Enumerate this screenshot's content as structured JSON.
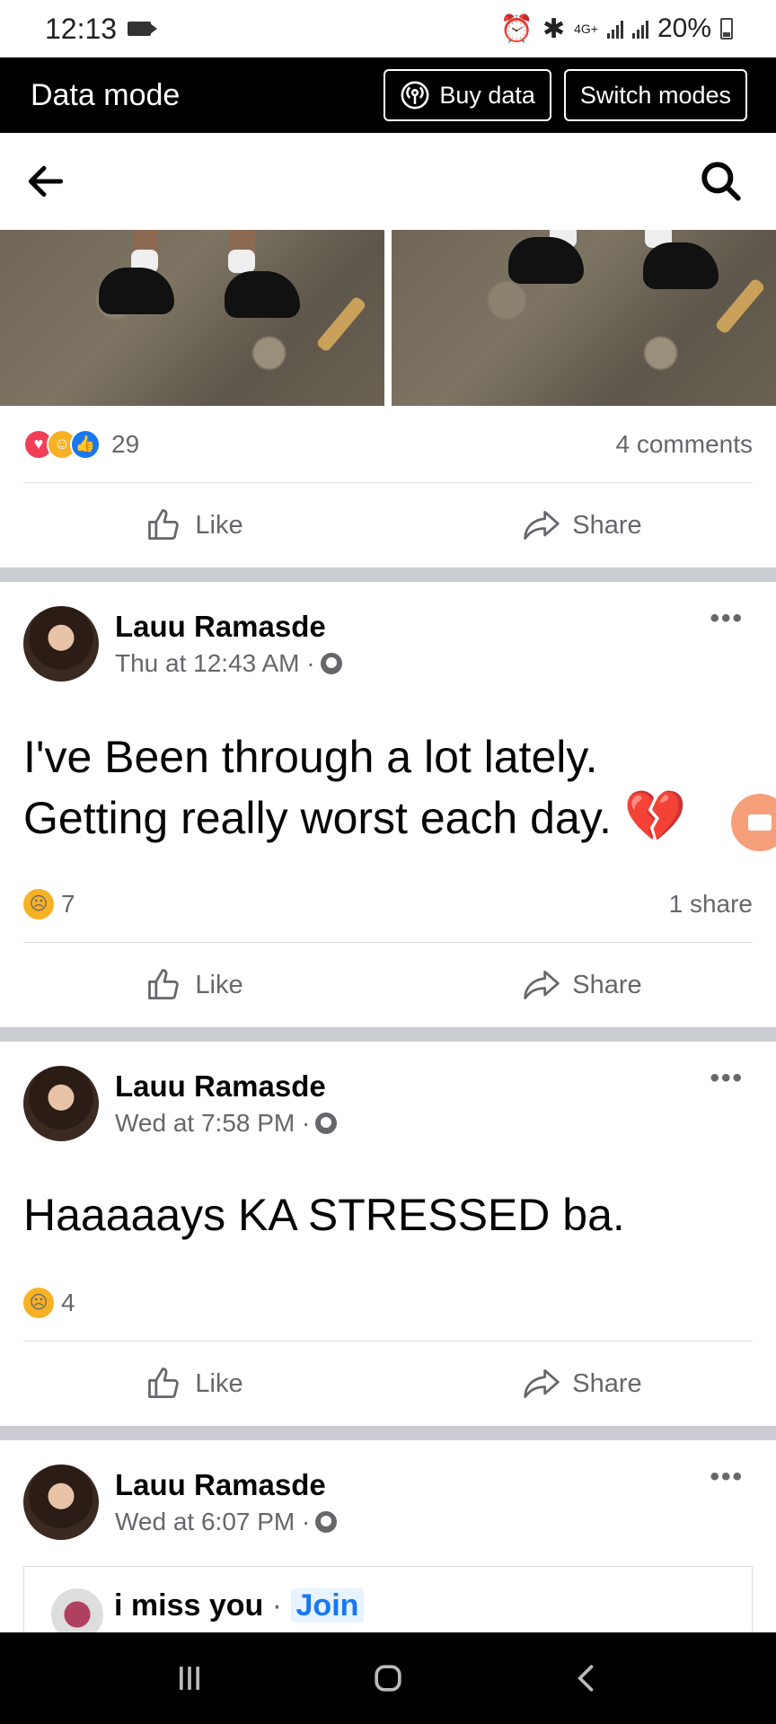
{
  "status_bar": {
    "time": "12:13",
    "network": "4G+",
    "battery": "20%"
  },
  "data_mode": {
    "title": "Data mode",
    "buy_label": "Buy data",
    "switch_label": "Switch modes"
  },
  "post0": {
    "reactions_count": "29",
    "comments": "4 comments",
    "like": "Like",
    "share": "Share"
  },
  "post1": {
    "author": "Lauu Ramasde",
    "time": "Thu at 12:43 AM ·",
    "text_line1": "I've Been through a lot lately.",
    "text_line2": "Getting really worst each day.",
    "emoji": "💔",
    "reactions_count": "7",
    "shares": "1 share",
    "like": "Like",
    "share": "Share"
  },
  "post2": {
    "author": "Lauu Ramasde",
    "time": "Wed at 7:58 PM ·",
    "text": "Haaaaays KA STRESSED ba.",
    "reactions_count": "4",
    "like": "Like",
    "share": "Share"
  },
  "post3": {
    "author": "Lauu Ramasde",
    "time": "Wed at 6:07 PM ·",
    "shared_title": "i miss you",
    "shared_sep": " · ",
    "join": "Join"
  },
  "icons": [
    "back-arrow-icon",
    "search-icon",
    "like-icon",
    "share-icon",
    "globe-icon",
    "more-icon"
  ]
}
